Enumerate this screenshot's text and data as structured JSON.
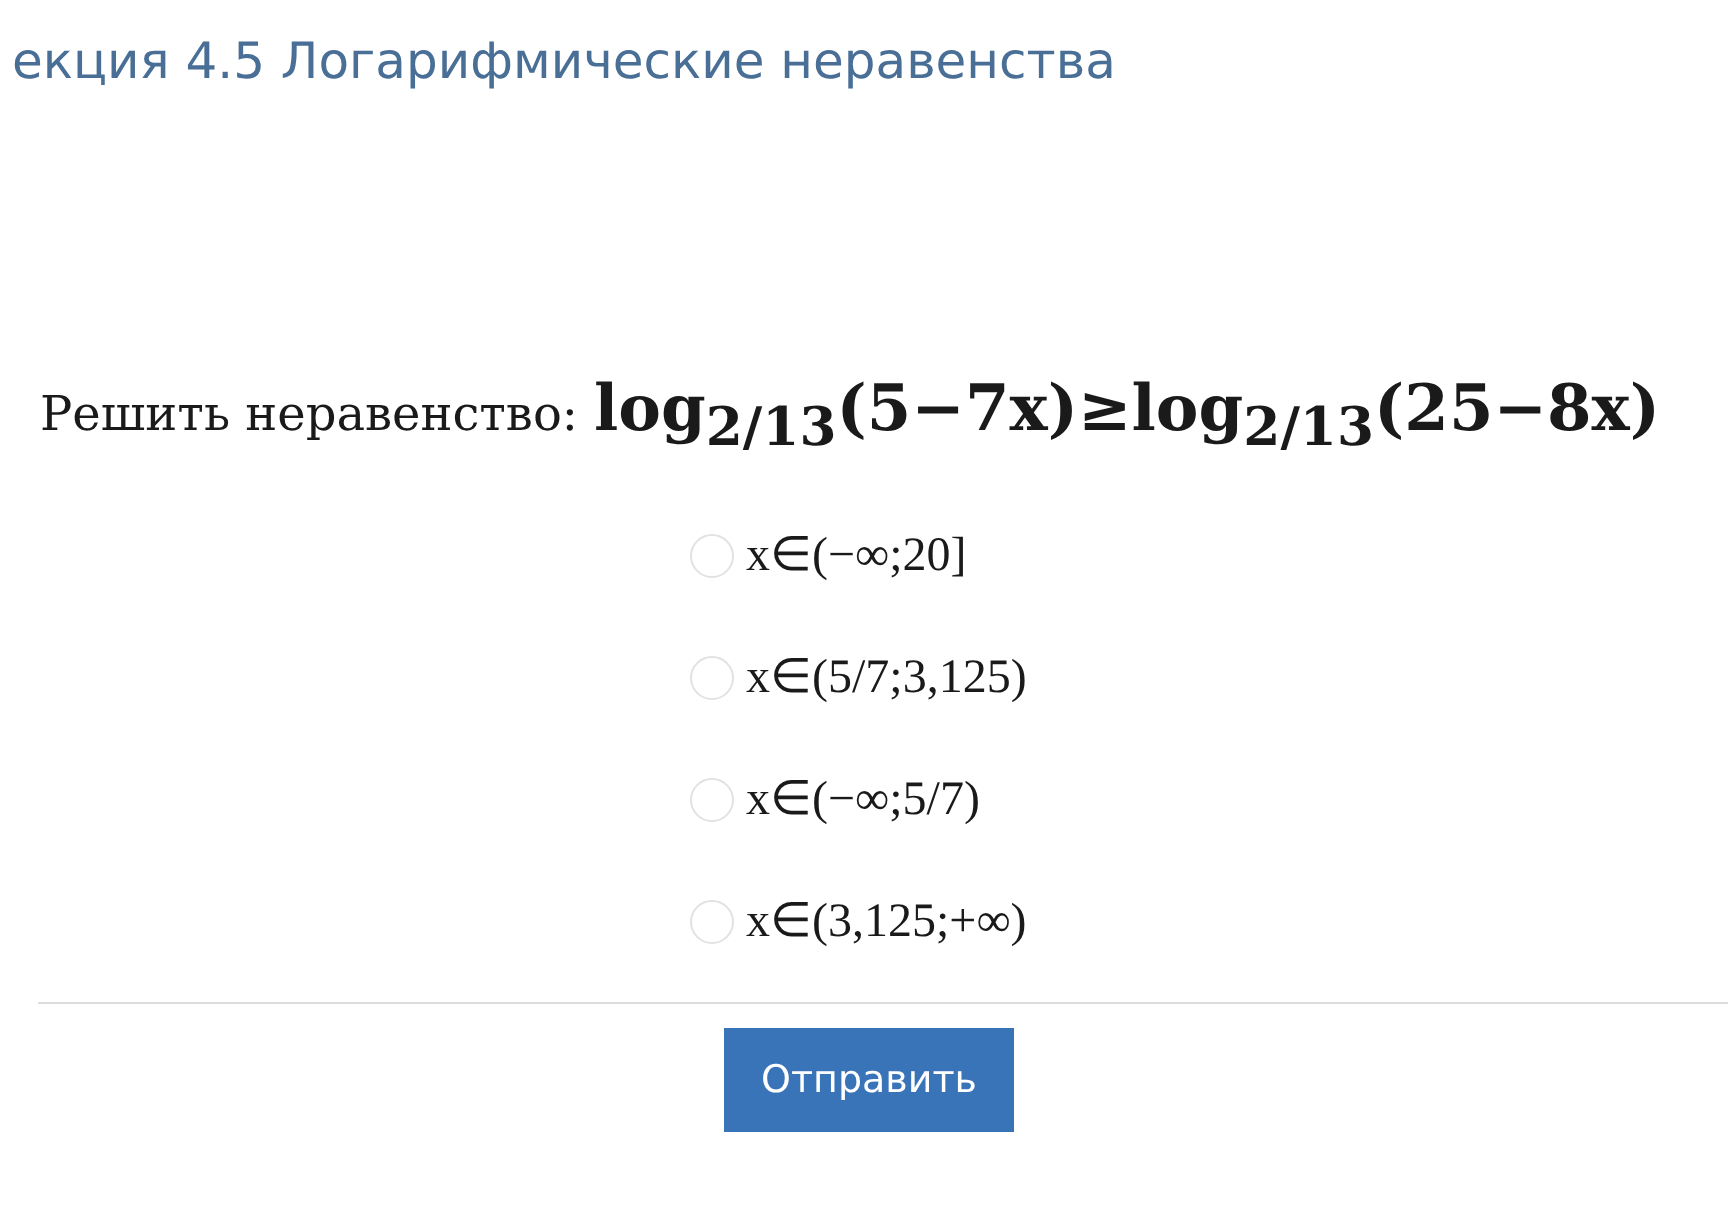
{
  "title": "екция 4.5 Логарифмические неравенства",
  "question": {
    "prompt": "Решить неравенство:",
    "formula": "log$_{2/13}$(5−7x)≥log$_{2/13}$(25−8x)"
  },
  "options": [
    {
      "label": "x∈(−∞;20]",
      "selected": false
    },
    {
      "label": "x∈(5/7;3,125)",
      "selected": false
    },
    {
      "label": "x∈(−∞;5/7)",
      "selected": false
    },
    {
      "label": "x∈(3,125;+∞)",
      "selected": false
    }
  ],
  "submit_button": "Отправить"
}
